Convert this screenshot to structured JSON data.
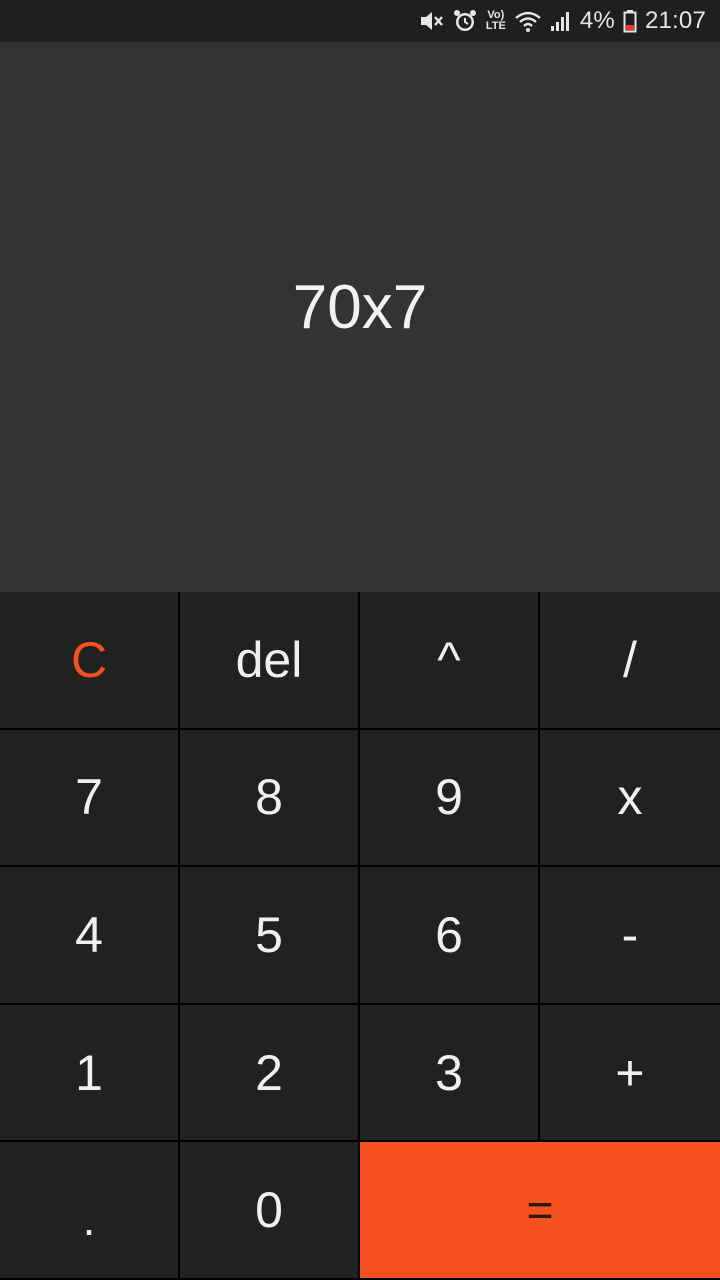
{
  "status_bar": {
    "battery_percent": "4%",
    "time": "21:07",
    "icons": [
      "mute-icon",
      "alarm-icon",
      "volte-icon",
      "wifi-icon",
      "signal-icon",
      "battery-icon"
    ],
    "volte_top": "Vo)",
    "volte_bottom": "LTE"
  },
  "display": {
    "expression": "70x7"
  },
  "keypad": {
    "keys": [
      {
        "label": "C",
        "name": "clear-button"
      },
      {
        "label": "del",
        "name": "delete-button"
      },
      {
        "label": "^",
        "name": "power-button"
      },
      {
        "label": "/",
        "name": "divide-button"
      },
      {
        "label": "7",
        "name": "digit-7-button"
      },
      {
        "label": "8",
        "name": "digit-8-button"
      },
      {
        "label": "9",
        "name": "digit-9-button"
      },
      {
        "label": "x",
        "name": "multiply-button"
      },
      {
        "label": "4",
        "name": "digit-4-button"
      },
      {
        "label": "5",
        "name": "digit-5-button"
      },
      {
        "label": "6",
        "name": "digit-6-button"
      },
      {
        "label": "-",
        "name": "subtract-button"
      },
      {
        "label": "1",
        "name": "digit-1-button"
      },
      {
        "label": "2",
        "name": "digit-2-button"
      },
      {
        "label": "3",
        "name": "digit-3-button"
      },
      {
        "label": "+",
        "name": "add-button"
      },
      {
        "label": ".",
        "name": "decimal-button"
      },
      {
        "label": "0",
        "name": "digit-0-button"
      },
      {
        "label": "=",
        "name": "equals-button"
      }
    ]
  },
  "colors": {
    "accent": "#f4511e",
    "display_bg": "#333333",
    "key_bg": "#212121",
    "status_bar_bg": "#1f1f1f"
  }
}
